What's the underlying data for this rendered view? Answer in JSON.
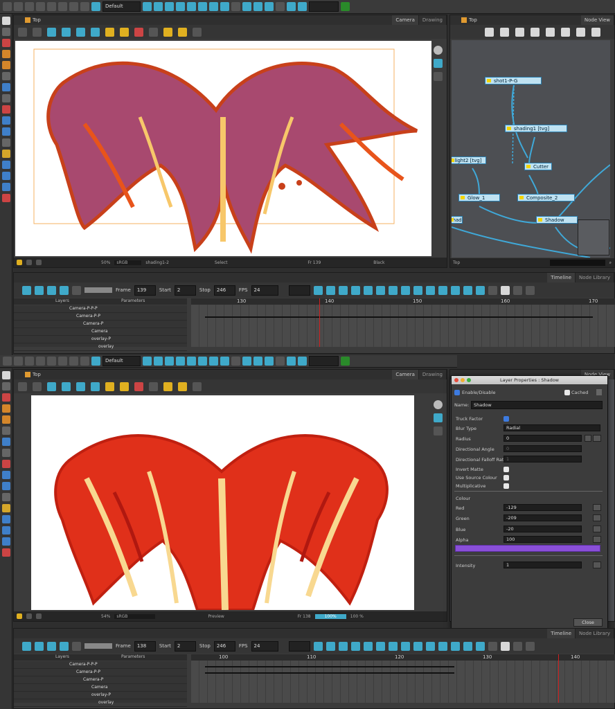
{
  "top": {
    "toolbar": {
      "workspace_select": "Default"
    },
    "camera_view": {
      "breadcrumb": "Top",
      "tabs": [
        "Camera",
        "Drawing"
      ],
      "status": {
        "zoom": "50%",
        "color_space": "sRGB",
        "drawing_name": "shading1-2",
        "mode": "Select",
        "frame": "Fr 139",
        "bg": "Black"
      }
    },
    "node_view": {
      "tab": "Node View",
      "breadcrumb": "Top",
      "footer": "Top",
      "nodes": [
        {
          "label": "shot1-P-G"
        },
        {
          "label": "shading1 [tvg]"
        },
        {
          "label": "hlight2 [tvg]"
        },
        {
          "label": "Cutter"
        },
        {
          "label": "Glow_1"
        },
        {
          "label": "Composite_2"
        },
        {
          "label": "Shadow"
        },
        {
          "label": "Shadow"
        }
      ]
    },
    "timeline": {
      "tabs": [
        "Timeline",
        "Node Library"
      ],
      "frame_label": "Frame",
      "frame": "139",
      "start_label": "Start",
      "start": "2",
      "stop_label": "Stop",
      "stop": "246",
      "fps_label": "FPS",
      "fps": "24",
      "headers": {
        "layers": "Layers",
        "parameters": "Parameters"
      },
      "ruler": [
        "130",
        "140",
        "150",
        "160",
        "170"
      ],
      "layers": [
        "Camera-P-P-P",
        "Camera-P-P",
        "Camera-P",
        "Camera",
        "overlay-P",
        "overlay"
      ]
    }
  },
  "bottom": {
    "toolbar": {
      "workspace_select": "Default"
    },
    "camera_view": {
      "breadcrumb": "Top",
      "tabs": [
        "Camera",
        "Drawing"
      ],
      "status": {
        "zoom": "54%",
        "color_space": "sRGB",
        "mode": "Preview",
        "frame": "Fr 138",
        "zoom2": "100%",
        "bg": "100 %"
      }
    },
    "layer_properties": {
      "title": "Layer Properties : Shadow",
      "enable_label": "Enable/Disable",
      "cached_label": "Cached",
      "name_label": "Name:",
      "name_value": "Shadow",
      "rows": [
        {
          "label": "Truck Factor"
        },
        {
          "label": "Blur Type",
          "value": "Radial"
        },
        {
          "label": "Radius",
          "value": "0"
        },
        {
          "label": "Directional Angle",
          "value": "0"
        },
        {
          "label": "Directional Falloff Rate",
          "value": "1"
        },
        {
          "label": "Invert Matte"
        },
        {
          "label": "Use Source Colour"
        },
        {
          "label": "Multiplicative"
        }
      ],
      "colour_section": "Colour",
      "colour": [
        {
          "label": "Red",
          "value": "-129"
        },
        {
          "label": "Green",
          "value": "-209"
        },
        {
          "label": "Blue",
          "value": "-20"
        },
        {
          "label": "Alpha",
          "value": "100"
        }
      ],
      "intensity_label": "Intensity",
      "intensity_value": "1",
      "close_label": "Close",
      "swatch_color": "#8a4fd8"
    },
    "node_view_tab": "Node View",
    "timeline": {
      "tabs": [
        "Timeline",
        "Node Library"
      ],
      "frame_label": "Frame",
      "frame": "138",
      "start_label": "Start",
      "start": "2",
      "stop_label": "Stop",
      "stop": "246",
      "fps_label": "FPS",
      "fps": "24",
      "headers": {
        "layers": "Layers",
        "parameters": "Parameters"
      },
      "ruler": [
        "100",
        "110",
        "120",
        "130",
        "140"
      ],
      "layers": [
        "Camera-P-P-P",
        "Camera-P-P",
        "Camera-P",
        "Camera",
        "overlay-P",
        "overlay"
      ]
    }
  },
  "colors": {
    "accent": "#3fa9c9",
    "playhead": "#d02020",
    "panel": "#3b3b3b",
    "node_fill": "#bfe2f2"
  }
}
